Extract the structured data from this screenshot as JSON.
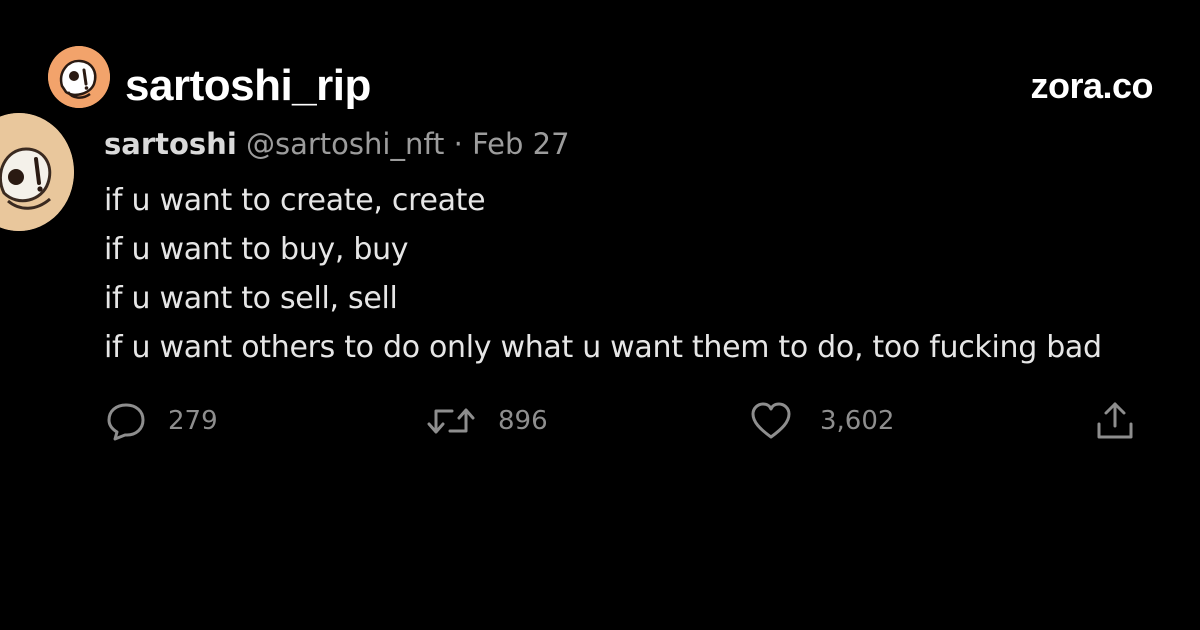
{
  "brand": {
    "name": "sartoshi_rip",
    "site": "zora.co",
    "avatar_icon": "cartoon-avatar-icon",
    "accent_color": "#f2a36b"
  },
  "tweet": {
    "display_name": "sartoshi",
    "handle": "@sartoshi_nft",
    "separator": "·",
    "date": "Feb 27",
    "lines": [
      "if u want to create, create",
      "if u want to buy, buy",
      "if u want to sell, sell",
      "if u want others to do only what u want them to do, too fucking bad"
    ],
    "actions": {
      "replies": {
        "icon": "reply-icon",
        "count": "279"
      },
      "retweets": {
        "icon": "retweet-icon",
        "count": "896"
      },
      "likes": {
        "icon": "heart-icon",
        "count": "3,602"
      },
      "share": {
        "icon": "share-icon"
      }
    }
  }
}
